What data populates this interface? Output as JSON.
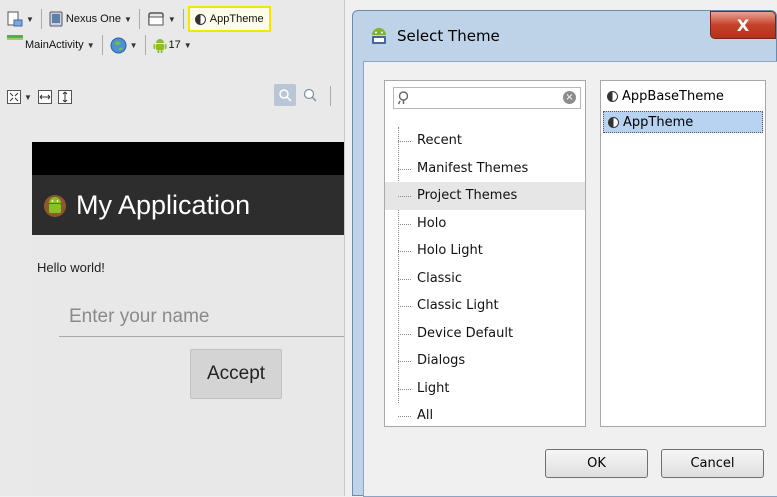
{
  "toolbar": {
    "device": "Nexus One",
    "theme": "AppTheme",
    "activity": "MainActivity",
    "api_level": "17"
  },
  "preview": {
    "app_title": "My Application",
    "hello_text": "Hello world!",
    "name_placeholder": "Enter your name",
    "accept_label": "Accept"
  },
  "dialog": {
    "title": "Select Theme",
    "close_label": "X",
    "search_value": "",
    "categories": [
      {
        "label": "Recent"
      },
      {
        "label": "Manifest Themes"
      },
      {
        "label": "Project Themes",
        "selected": true
      },
      {
        "label": "Holo"
      },
      {
        "label": "Holo Light"
      },
      {
        "label": "Classic"
      },
      {
        "label": "Classic Light"
      },
      {
        "label": "Device Default"
      },
      {
        "label": "Dialogs"
      },
      {
        "label": "Light"
      },
      {
        "label": "All"
      }
    ],
    "themes": [
      {
        "label": "AppBaseTheme"
      },
      {
        "label": "AppTheme",
        "selected": true
      }
    ],
    "ok_label": "OK",
    "cancel_label": "Cancel"
  },
  "colors": {
    "theme_highlight": "#f3e600",
    "action_bar": "#2d2d2d",
    "selection": "#b7d3f1",
    "close_button": "#c4412b",
    "android_green": "#8cbf26"
  },
  "icons": {
    "device_screen": "device-icon",
    "orientation": "orientation-icon",
    "theme": "theme-icon",
    "locale": "globe-icon",
    "api": "android-icon",
    "search": "search-icon",
    "clear": "clear-icon"
  }
}
